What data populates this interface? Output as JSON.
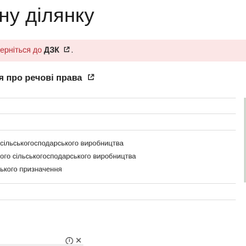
{
  "page": {
    "title": "ну ділянку"
  },
  "alert": {
    "text": "ерніться до",
    "link_label": "ДЗК",
    "period": "."
  },
  "rights_link": {
    "label": "я про речові права"
  },
  "purpose_list": [
    "сільськогосподарського виробництва",
    "ого сільськогосподарського виробництва",
    "ького призначення"
  ],
  "consent": {
    "info_glyph": "i",
    "close_glyph": "✕"
  },
  "colors": {
    "alert_bg": "#fbe6e6",
    "alert_text": "#b3262e"
  }
}
